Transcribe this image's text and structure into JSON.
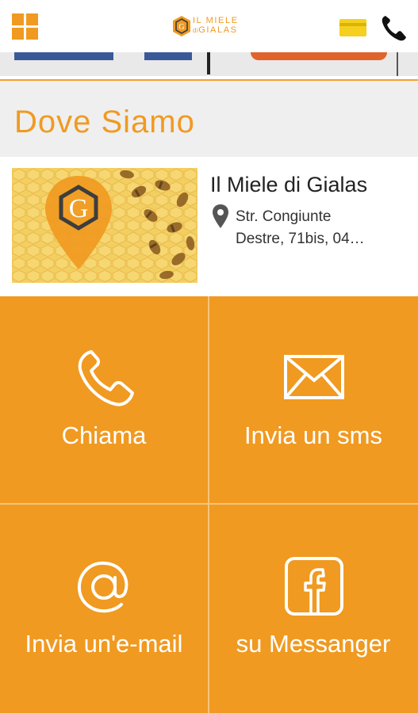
{
  "header": {
    "logo_line1": "IL MIELE",
    "logo_line2_small": "di",
    "logo_line2": "GIALAS",
    "logo_initial": "G"
  },
  "section": {
    "title": "Dove Siamo"
  },
  "location": {
    "name": "Il Miele di Gialas",
    "address_line1": "Str. Congiunte",
    "address_line2": "Destre, 71bis, 04…",
    "pin_initial": "G"
  },
  "actions": {
    "call": "Chiama",
    "sms": "Invia un sms",
    "email": "Invia un'e-mail",
    "messenger": "su Messanger"
  },
  "colors": {
    "accent": "#f09a21",
    "card_icon": "#f5d020"
  },
  "icons": [
    "menu-grid-icon",
    "card-icon",
    "phone-icon",
    "map-pin-icon",
    "envelope-icon",
    "at-icon",
    "facebook-icon"
  ]
}
